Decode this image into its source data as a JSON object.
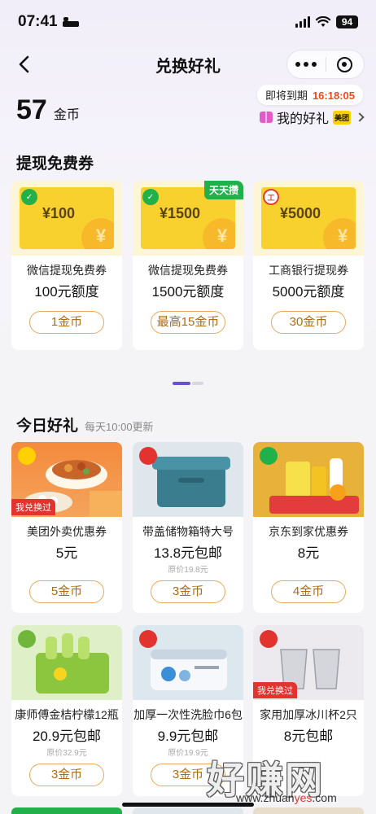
{
  "status_bar": {
    "time": "07:41",
    "battery": "94"
  },
  "nav": {
    "title": "兑换好礼"
  },
  "coins": {
    "amount": "57",
    "unit": "金币"
  },
  "expire": {
    "label": "即将到期",
    "countdown": "16:18:05"
  },
  "my_gift": {
    "label": "我的好礼",
    "badge": "美团"
  },
  "withdraw_section": {
    "title": "提现免费券",
    "cards": [
      {
        "amount": "¥100",
        "name": "微信提现免费券",
        "quota": "100元额度",
        "price": "1金币",
        "tag": ""
      },
      {
        "amount": "¥1500",
        "name": "微信提现免费券",
        "quota": "1500元额度",
        "price": "最高15金币",
        "tag": "天天攒"
      },
      {
        "amount": "¥5000",
        "name": "工商银行提现券",
        "quota": "5000元额度",
        "price": "30金币",
        "tag": ""
      }
    ]
  },
  "today_section": {
    "title": "今日好礼",
    "subtitle": "每天10:00更新",
    "exchanged_tag": "我兑换过",
    "items": [
      {
        "name": "美团外卖优惠券",
        "price": "5元",
        "original": "",
        "cost": "5金币",
        "exchanged": true
      },
      {
        "name": "带盖储物箱特大号",
        "price": "13.8元包邮",
        "original": "原价19.8元",
        "cost": "3金币",
        "exchanged": false
      },
      {
        "name": "京东到家优惠券",
        "price": "8元",
        "original": "",
        "cost": "4金币",
        "exchanged": false
      },
      {
        "name": "康师傅金桔柠檬12瓶",
        "price": "20.9元包邮",
        "original": "原价32.9元",
        "cost": "3金币",
        "exchanged": false
      },
      {
        "name": "加厚一次性洗脸巾6包",
        "price": "9.9元包邮",
        "original": "原价19.9元",
        "cost": "3金币",
        "exchanged": false
      },
      {
        "name": "家用加厚冰川杯2只",
        "price": "8元包邮",
        "original": "",
        "cost": "",
        "exchanged": true
      }
    ]
  },
  "watermark": {
    "text": "好赚网",
    "url_a": "www.zhuan",
    "url_b": "yes",
    "url_c": ".com"
  },
  "colors": {
    "accent": "#6b4fd8",
    "price_border": "#e7a95c",
    "countdown": "#f04a1a",
    "tag_red": "#e2332e",
    "wechat_green": "#22b04a"
  }
}
